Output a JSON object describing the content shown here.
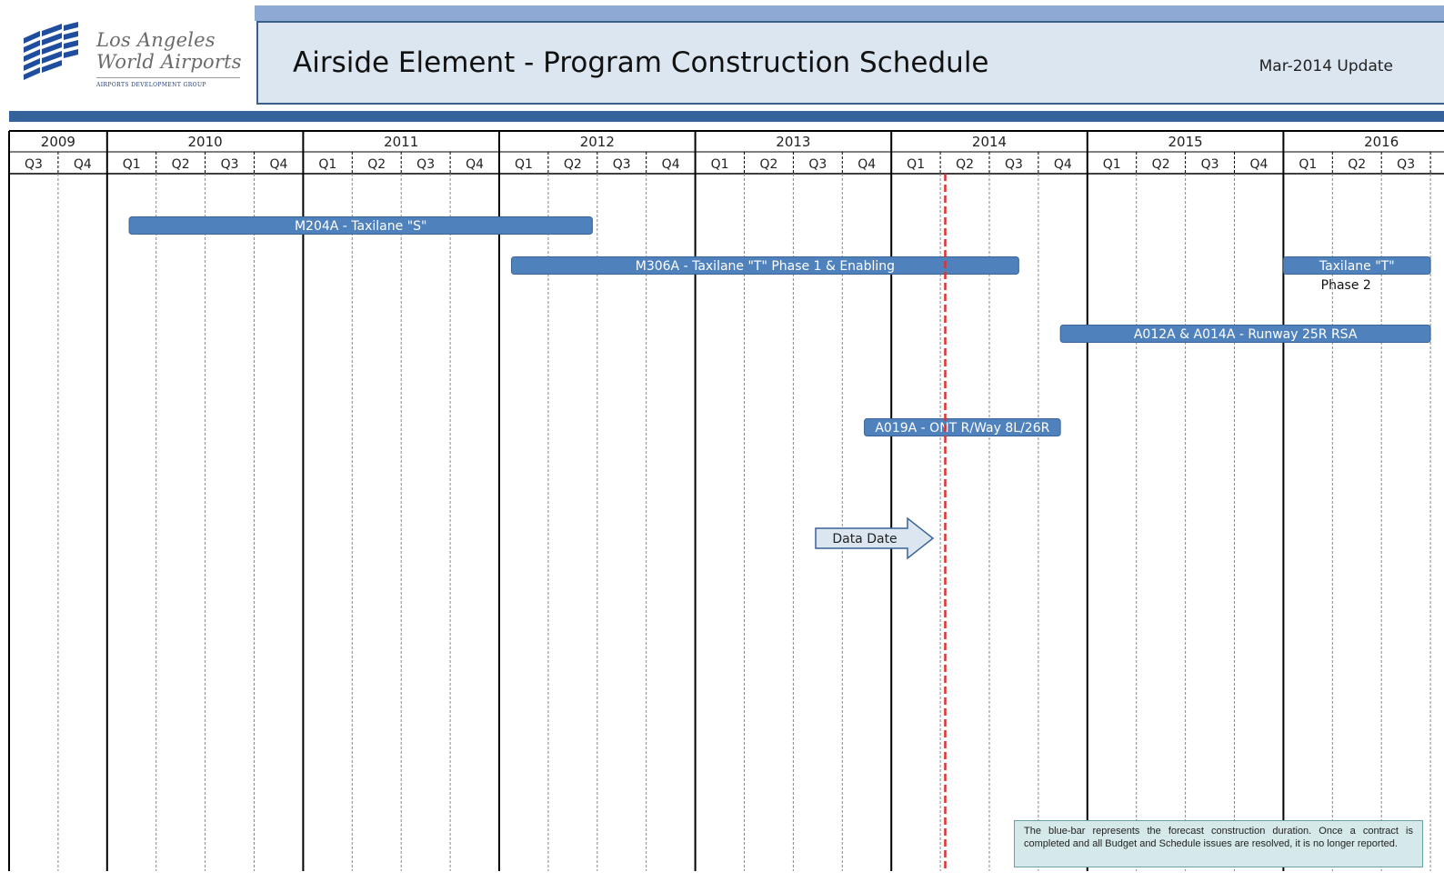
{
  "header": {
    "logo_line1": "Los Angeles",
    "logo_line2": "World Airports",
    "logo_sub": "AIRPORTS DEVELOPMENT GROUP",
    "title": "Airside Element - Program Construction Schedule",
    "update": "Mar-2014 Update"
  },
  "colors": {
    "bar": "#4f81bd",
    "bar_border": "#3a6496",
    "band": "#35629a",
    "title_bg": "#dce6f1",
    "data_date_line": "#e03030",
    "arrow_fill": "#dce6f1"
  },
  "chart_data": {
    "type": "gantt",
    "timeline": {
      "start": "2009-Q3",
      "end": "2016-Q3",
      "years": [
        "2009",
        "2010",
        "2011",
        "2012",
        "2013",
        "2014",
        "2015",
        "2016"
      ],
      "quarters": [
        "Q3",
        "Q4",
        "Q1",
        "Q2",
        "Q3",
        "Q4",
        "Q1",
        "Q2",
        "Q3",
        "Q4",
        "Q1",
        "Q2",
        "Q3",
        "Q4",
        "Q1",
        "Q2",
        "Q3",
        "Q4",
        "Q1",
        "Q2",
        "Q3",
        "Q4",
        "Q1",
        "Q2",
        "Q3",
        "Q4",
        "Q1",
        "Q2",
        "Q3"
      ]
    },
    "tasks": [
      {
        "label": "M204A - Taxilane \"S\"",
        "start": 2.45,
        "end": 11.9,
        "external_label": ""
      },
      {
        "label": "M306A - Taxilane \"T\"  Phase 1 & Enabling",
        "start": 10.25,
        "end": 20.6,
        "external_label": ""
      },
      {
        "label": "Taxilane \"T\"",
        "start": 26.0,
        "end": 29.0,
        "external_label": "Phase 2"
      },
      {
        "label": "A012A & A014A - Runway 25R RSA",
        "start": 21.45,
        "end": 29.0,
        "external_label": ""
      },
      {
        "label": "A019A - ONT R/Way 8L/26R",
        "start": 17.45,
        "end": 21.45,
        "external_label": ""
      }
    ],
    "data_date": {
      "label": "Data Date",
      "position": 19.1
    },
    "note": "The blue-bar represents the forecast construction duration.  Once a contract is completed and all Budget and Schedule issues are resolved,  it is no longer reported."
  }
}
